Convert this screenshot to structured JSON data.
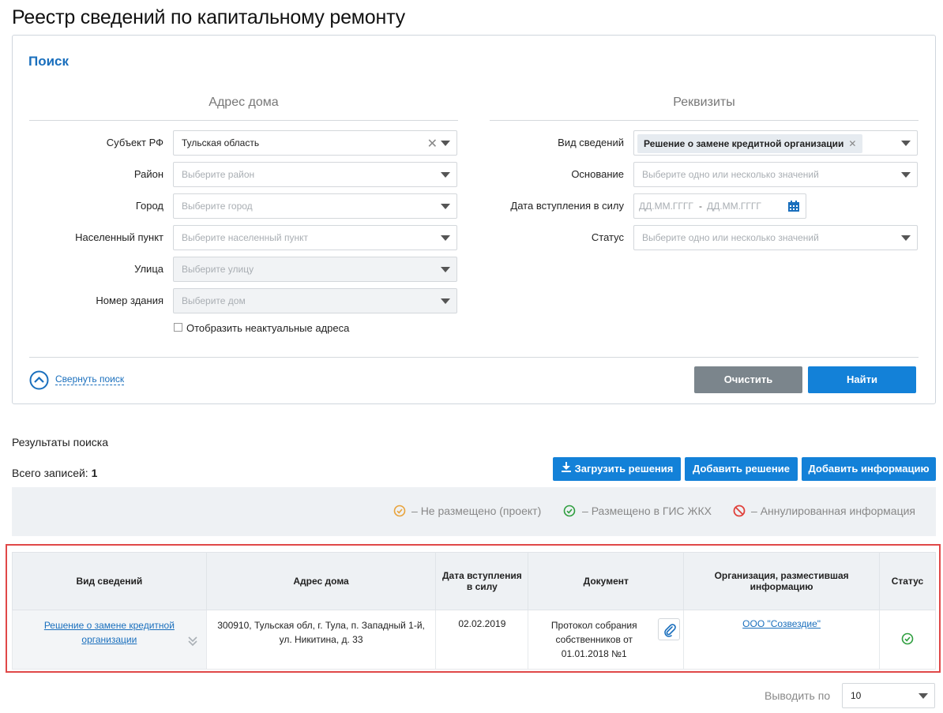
{
  "page": {
    "title": "Реестр сведений по капитальному ремонту"
  },
  "search": {
    "heading": "Поиск",
    "address_section": "Адрес дома",
    "requisites_section": "Реквизиты",
    "fields": {
      "subject_label": "Субъект РФ",
      "subject_value": "Тульская область",
      "district_label": "Район",
      "district_placeholder": "Выберите район",
      "city_label": "Город",
      "city_placeholder": "Выберите город",
      "settlement_label": "Населенный пункт",
      "settlement_placeholder": "Выберите населенный пункт",
      "street_label": "Улица",
      "street_placeholder": "Выберите улицу",
      "building_label": "Номер здания",
      "building_placeholder": "Выберите дом",
      "show_inactive_label": "Отобразить неактуальные адреса",
      "info_type_label": "Вид сведений",
      "info_type_tag": "Решение о замене кредитной организации",
      "basis_label": "Основание",
      "basis_placeholder": "Выберите одно или несколько значений",
      "effective_date_label": "Дата вступления в силу",
      "date_from_placeholder": "ДД.ММ.ГГГГ",
      "date_separator": "-",
      "date_to_placeholder": "ДД.ММ.ГГГГ",
      "status_label": "Статус",
      "status_placeholder": "Выберите одно или несколько значений"
    },
    "collapse_label": "Свернуть поиск",
    "clear_button": "Очистить",
    "find_button": "Найти"
  },
  "results": {
    "heading": "Результаты поиска",
    "total_label": "Всего записей:",
    "total_count": "1",
    "upload_button": "Загрузить решения",
    "add_decision_button": "Добавить решение",
    "add_info_button": "Добавить информацию",
    "legend": [
      {
        "label": "Не размещено (проект)",
        "color": "#e8a33b",
        "icon": "check-circle-icon"
      },
      {
        "label": "Размещено в ГИС ЖКХ",
        "color": "#2e9e3e",
        "icon": "check-circle-icon"
      },
      {
        "label": "Аннулированная информация",
        "color": "#e0403a",
        "icon": "cancel-icon"
      }
    ],
    "legend_dash": "–",
    "columns": [
      "Вид сведений",
      "Адрес дома",
      "Дата вступления в силу",
      "Документ",
      "Организация, разместившая информацию",
      "Статус"
    ],
    "rows": [
      {
        "info_type": "Решение о замене кредитной организации",
        "address": "300910, Тульская обл, г. Тула, п. Западный 1-й, ул. Никитина, д. 33",
        "date": "02.02.2019",
        "document": "Протокол собрания собственников от 01.01.2018 №1",
        "organization": "ООО \"Созвездие\"",
        "status_color": "#2e9e3e"
      }
    ],
    "page_size_label": "Выводить по",
    "page_size_value": "10"
  },
  "colors": {
    "accent": "#1381d8",
    "highlight_border": "#e04848"
  }
}
